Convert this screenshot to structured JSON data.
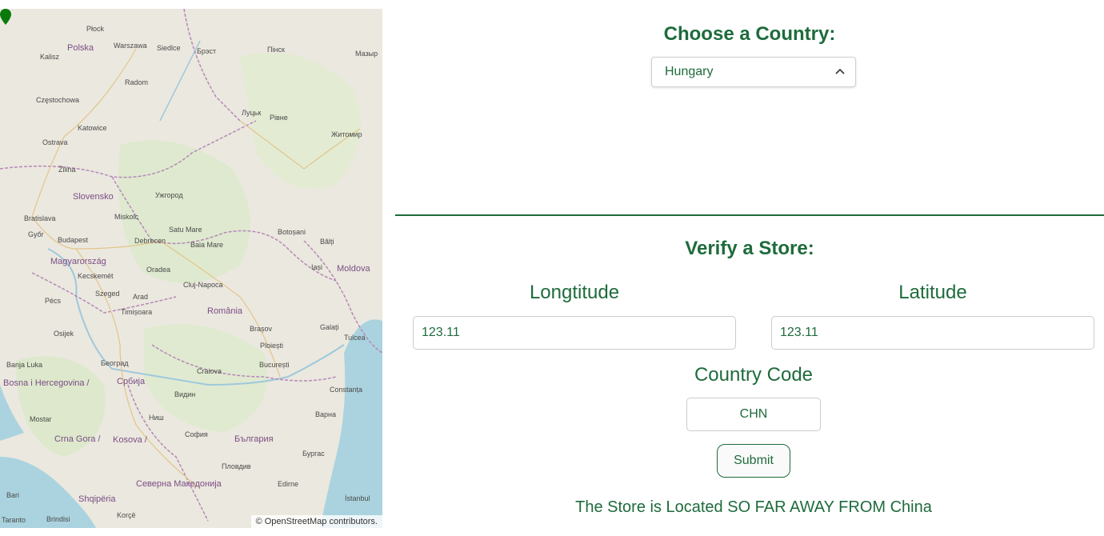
{
  "map": {
    "attribution": "© OpenStreetMap contributors.",
    "labels": {
      "plock": "Płock",
      "warszawa": "Warszawa",
      "siedlce": "Siedlce",
      "brest": "Брэст",
      "pinsk": "Пінск",
      "mazyr": "Мазыр",
      "kalisz": "Kalisz",
      "polska": "Polska",
      "radom": "Radom",
      "czestochowa": "Częstochowa",
      "lutsk": "Луцьк",
      "rivne": "Рівне",
      "zhytomyr": "Житомир",
      "katowice": "Katowice",
      "ostrava": "Ostrava",
      "zilina": "Žilina",
      "slovensko": "Slovensko",
      "uzhhorod": "Ужгород",
      "bratislava": "Bratislava",
      "miskolc": "Miskolc",
      "gyor": "Győr",
      "budapest": "Budapest",
      "debrecen": "Debrecen",
      "satu_mare": "Satu Mare",
      "baia_mare": "Baia Mare",
      "botosani": "Botoșani",
      "balti": "Bălți",
      "magyarorszag": "Magyarország",
      "oradea": "Oradea",
      "kecskemet": "Kecskemét",
      "cluj": "Cluj-Napoca",
      "iasi": "Iași",
      "moldova": "Moldova",
      "szeged": "Szeged",
      "pecs": "Pécs",
      "arad": "Arad",
      "timisoara": "Timișoara",
      "romania": "România",
      "brasov": "Brașov",
      "galati": "Galați",
      "osijek": "Osijek",
      "banja_luka": "Banja Luka",
      "beograd": "Београд",
      "craiova": "Craiova",
      "ploiesti": "Ploiești",
      "bucuresti": "București",
      "constanta": "Constanța",
      "bosna": "Bosna i Hercegovina /",
      "srbija": "Србија",
      "varna": "Варна",
      "sofia": "София",
      "bulgaria": "България",
      "mostar": "Mostar",
      "crna_gora": "Crna Gora /",
      "kosova": "Kosova /",
      "burgas": "Бургас",
      "plovdiv": "Пловдив",
      "edirne": "Edirne",
      "shqiperia": "Shqipëria",
      "bari": "Bari",
      "taranto": "Taranto",
      "brindisi": "Brindisi",
      "makedonija": "Северна Македонија",
      "istanbul": "İstanbul",
      "tulcea": "Tulcea",
      "vidin": "Видин",
      "nis": "Ниш",
      "korce": "Korçë"
    }
  },
  "country": {
    "title": "Choose a Country:",
    "selected": "Hungary"
  },
  "store": {
    "title": "Verify a Store:",
    "longitude_label": "Longtitude",
    "latitude_label": "Latitude",
    "longitude_value": "123.11",
    "latitude_value": "123.11",
    "country_code_label": "Country Code",
    "country_code_value": "CHN",
    "submit_label": "Submit",
    "result": "The Store is Located SO FAR AWAY FROM China"
  },
  "colors": {
    "accent": "#1e6b3c",
    "marker": "#0a7a0a",
    "sea": "#aad3df"
  }
}
